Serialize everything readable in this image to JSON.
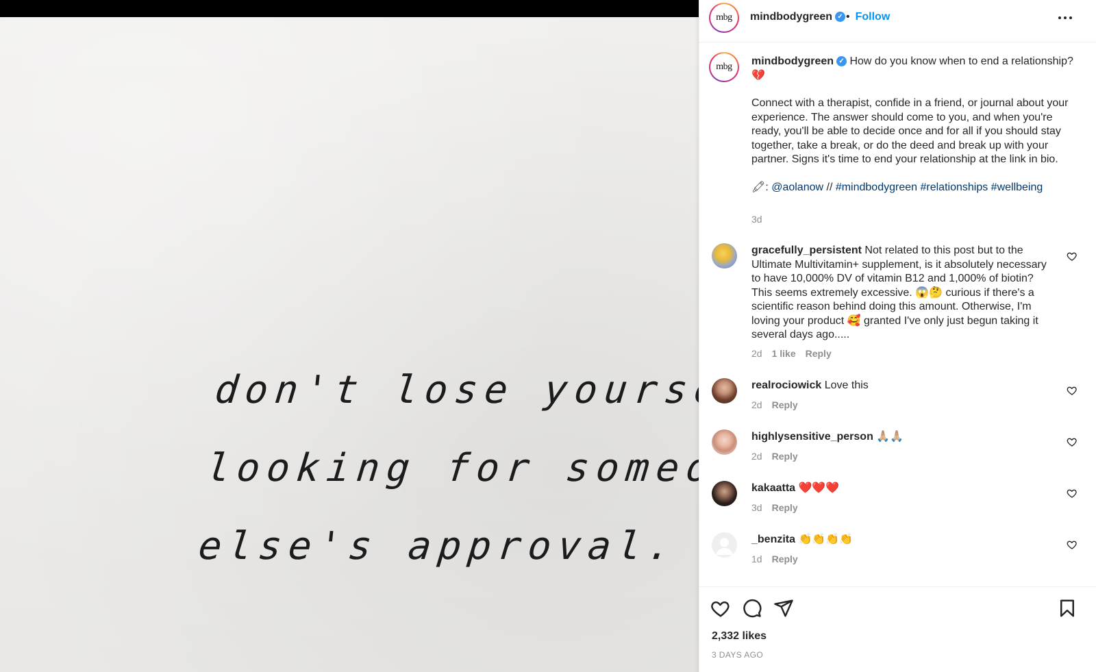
{
  "image": {
    "quote_lines": [
      "don't lose yourself",
      "looking for someone",
      "else's approval."
    ]
  },
  "post": {
    "username": "mindbodygreen",
    "avatar_text": "mbg",
    "follow_label": "Follow",
    "separator": "•",
    "more_icon": "more-horizontal-icon",
    "verified_icon": "verified-badge-icon"
  },
  "caption": {
    "username": "mindbodygreen",
    "intro": "How do you know when to end a relationship? 💔",
    "body": "Connect with a therapist, confide in a friend, or journal about your experience. The answer should come to you, and when you're ready, you'll be able to decide once and for all if you should stay together, take a break, or do the deed and break up with your partner. Signs it's time to end your relationship at the link in bio.",
    "credit_prefix": "🖍: ",
    "credit_handle": "@aolanow",
    "credit_sep": " // ",
    "hashtags": [
      "#mindbodygreen",
      "#relationships",
      "#wellbeing"
    ],
    "time": "3d"
  },
  "comments": [
    {
      "username": "gracefully_persistent",
      "text": "Not related to this post but to the Ultimate Multivitamin+ supplement, is it absolutely necessary to have 10,000% DV of vitamin B12 and 1,000% of biotin? This seems extremely excessive. 😱🤔 curious if there's a scientific reason behind doing this amount. Otherwise, I'm loving your product 🥰 granted I've only just begun taking it several days ago.....",
      "time": "2d",
      "likes": "1 like",
      "reply": "Reply"
    },
    {
      "username": "realrociowick",
      "text": "Love this",
      "time": "2d",
      "reply": "Reply"
    },
    {
      "username": "highlysensitive_person",
      "text": "🙏🏼🙏🏼",
      "time": "2d",
      "reply": "Reply"
    },
    {
      "username": "kakaatta",
      "text": "❤️❤️❤️",
      "time": "3d",
      "reply": "Reply"
    },
    {
      "username": "_benzita",
      "text": "👏👏👏👏",
      "time": "1d",
      "reply": "Reply"
    }
  ],
  "actions": {
    "likes": "2,332 likes",
    "date": "3 DAYS AGO",
    "icons": [
      "heart-icon",
      "comment-icon",
      "share-icon",
      "bookmark-icon"
    ]
  },
  "colors": {
    "link": "#00376b",
    "follow": "#0095f6",
    "verified": "#3897f0",
    "muted": "#8e8e8e"
  }
}
